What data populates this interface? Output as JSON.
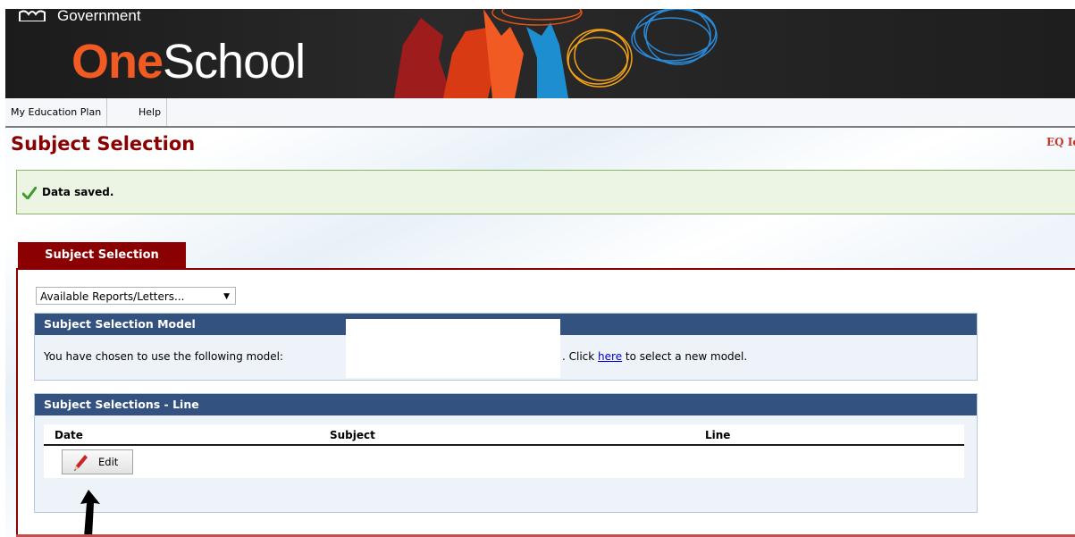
{
  "banner": {
    "gov_text": "Government",
    "logo_one": "One",
    "logo_school": "School",
    "icons": [
      "crest-icon",
      "silhouette-art"
    ]
  },
  "menu": {
    "items": [
      {
        "label": "My Education Plan"
      },
      {
        "label": "Help"
      }
    ]
  },
  "page": {
    "title": "Subject Selection",
    "eq_id": "EQ Id"
  },
  "alert": {
    "message": "Data saved.",
    "icon": "check-icon",
    "color": "#8bb469"
  },
  "tab": {
    "label": "Subject Selection"
  },
  "reports": {
    "selected": "Available Reports/Letters..."
  },
  "model_box": {
    "heading": "Subject Selection Model",
    "text_before": "You have chosen to use the following model:",
    "text_click": ". Click ",
    "link": "here",
    "text_after": " to select a new model."
  },
  "lines_box": {
    "heading": "Subject Selections - Line",
    "columns": [
      "Date",
      "Subject",
      "Line"
    ],
    "edit_label": "Edit"
  },
  "colors": {
    "accent_red": "#8b0000",
    "header_blue": "#33527f",
    "logo_orange": "#f15a22"
  }
}
